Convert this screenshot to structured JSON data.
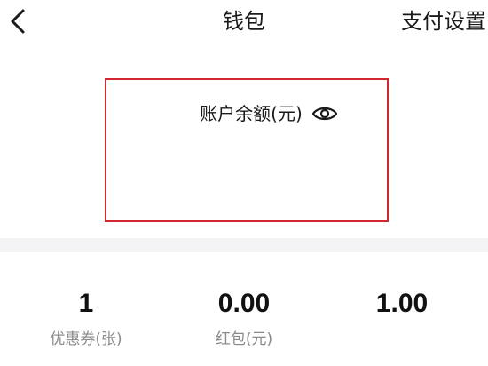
{
  "header": {
    "title": "钱包",
    "settings_label": "支付设置"
  },
  "balance": {
    "label": "账户余额(元)"
  },
  "stats": [
    {
      "value": "1",
      "label": "优惠券(张)"
    },
    {
      "value": "0.00",
      "label": "红包(元)"
    },
    {
      "value": "1.00",
      "label": ""
    }
  ],
  "icons": {
    "back": "chevron-left-icon",
    "visibility": "eye-icon"
  },
  "colors": {
    "highlight_border": "#d0282e",
    "divider_band": "#f4f4f6",
    "label_gray": "#8a8a8a"
  }
}
